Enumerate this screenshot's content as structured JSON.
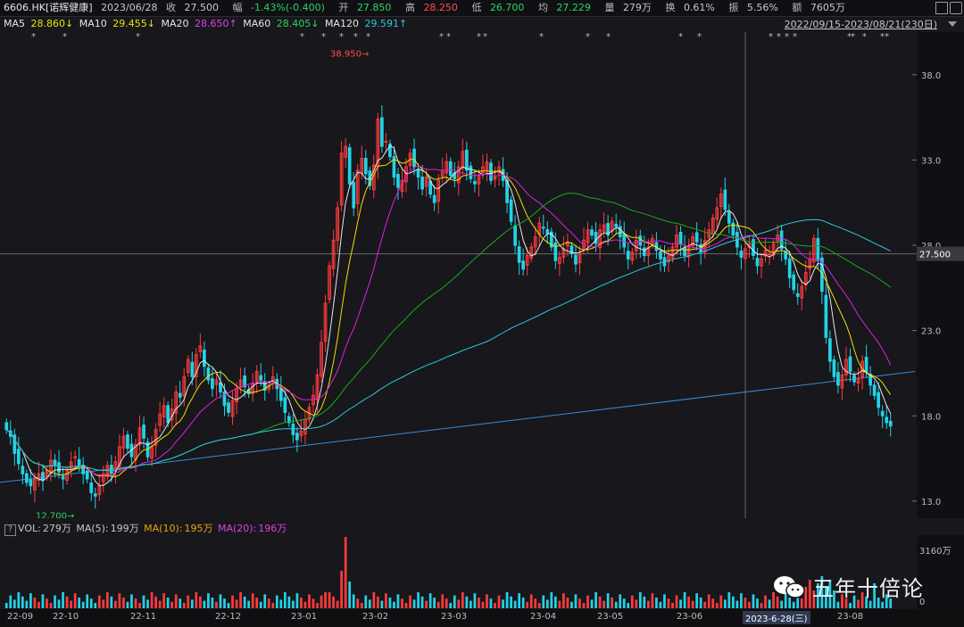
{
  "header": {
    "symbol": "6606.HK[诺辉健康]",
    "date": "2023/06/28",
    "close_label": "收",
    "close": "27.500",
    "change_label": "幅",
    "change": "-1.43%(-0.400)",
    "open_label": "开",
    "open": "27.850",
    "high_label": "高",
    "high": "28.250",
    "low_label": "低",
    "low": "26.700",
    "avg_label": "均",
    "avg": "27.229",
    "vol_label": "量",
    "vol": "279万",
    "turnover_label": "换",
    "turnover": "0.61%",
    "amp_label": "振",
    "amp": "5.56%",
    "amount_label": "额",
    "amount": "7605万"
  },
  "ma_legend": {
    "ma5_label": "MA5",
    "ma5": "28.860↓",
    "ma10_label": "MA10",
    "ma10": "29.455↓",
    "ma20_label": "MA20",
    "ma20": "28.650↑",
    "ma60_label": "MA60",
    "ma60": "28.405↓",
    "ma120_label": "MA120",
    "ma120": "29.591↑"
  },
  "date_range": "2022/09/15-2023/08/21(230日)",
  "price_axis": {
    "ticks": [
      "38.0",
      "33.0",
      "28.0",
      "23.0",
      "18.0",
      "13.0"
    ],
    "current": "27.500"
  },
  "annotations": {
    "high": "38.950",
    "low": "12.700"
  },
  "volume_header": {
    "help": "?",
    "vol_label": "VOL:",
    "vol": "279万",
    "ma5_label": "MA(5):",
    "ma5": "199万",
    "ma10_label": "MA(10):",
    "ma10": "195万",
    "ma20_label": "MA(20):",
    "ma20": "196万"
  },
  "volume_axis": {
    "top": "3160万",
    "bottom": "0"
  },
  "x_axis": {
    "labels": [
      "22-09",
      "22-10",
      "22-11",
      "22-12",
      "23-01",
      "23-02",
      "23-03",
      "23-04",
      "23-05",
      "23-06",
      "23-08"
    ],
    "highlight": "2023-6-28(三)"
  },
  "watermark": "五年十倍论",
  "colors": {
    "up": "#ff3b3b",
    "down": "#23d2e6",
    "ma5": "#e6e6e6",
    "ma10": "#f0e000",
    "ma20": "#e020e0",
    "ma60": "#1fa81f",
    "ma120": "#2ec8d8",
    "trend": "#3a8ad8"
  },
  "chart_data": {
    "type": "candlestick",
    "ylim": [
      12.0,
      40.5
    ],
    "closes": [
      17.2,
      16.8,
      15.8,
      15.2,
      14.6,
      14.1,
      13.9,
      14.3,
      14.6,
      14.2,
      14.8,
      15.4,
      15.1,
      14.7,
      14.3,
      14.8,
      15.3,
      15.6,
      15.1,
      14.6,
      14.3,
      13.5,
      13.3,
      13.9,
      14.6,
      15.1,
      14.6,
      15.3,
      16.2,
      16.8,
      16.1,
      15.6,
      16.3,
      17.3,
      16.7,
      15.6,
      16.2,
      17.2,
      18.1,
      18.6,
      17.6,
      18.4,
      19.4,
      19.1,
      20.3,
      21.3,
      20.3,
      21.6,
      22.1,
      20.9,
      20.1,
      19.6,
      20.1,
      19.4,
      18.6,
      18.2,
      18.9,
      19.6,
      20.1,
      19.7,
      19.3,
      19.9,
      20.6,
      20.1,
      19.5,
      19.8,
      20.3,
      19.6,
      18.9,
      18.2,
      17.6,
      16.9,
      16.6,
      17.1,
      17.8,
      18.5,
      19.2,
      20.4,
      22.3,
      24.6,
      26.8,
      28.3,
      30.2,
      33.4,
      33.8,
      31.6,
      30.2,
      32.4,
      33.1,
      32.2,
      31.5,
      32.7,
      35.4,
      33.8,
      34.1,
      33.2,
      32.0,
      31.4,
      31.8,
      32.6,
      33.4,
      32.6,
      32.0,
      31.3,
      32.0,
      31.0,
      30.5,
      31.8,
      32.4,
      32.9,
      32.1,
      31.9,
      32.6,
      33.5,
      32.4,
      31.9,
      31.6,
      32.1,
      32.6,
      32.9,
      31.8,
      32.0,
      32.6,
      31.8,
      30.5,
      29.4,
      28.0,
      27.0,
      26.6,
      27.4,
      27.9,
      28.5,
      29.3,
      29.0,
      28.7,
      27.9,
      27.1,
      27.3,
      27.8,
      28.2,
      27.5,
      26.9,
      27.6,
      28.3,
      28.9,
      28.6,
      28.1,
      28.9,
      29.2,
      28.6,
      29.4,
      29.1,
      28.5,
      27.9,
      27.2,
      27.6,
      28.3,
      28.0,
      27.4,
      27.9,
      28.4,
      27.7,
      27.2,
      26.8,
      27.4,
      27.9,
      28.6,
      28.1,
      27.4,
      27.9,
      28.5,
      28.2,
      27.6,
      28.3,
      28.9,
      29.6,
      30.2,
      31.0,
      30.1,
      29.3,
      28.6,
      27.9,
      27.3,
      27.8,
      28.1,
      27.4,
      26.8,
      27.2,
      27.7,
      27.5,
      28.1,
      28.6,
      27.8,
      27.2,
      26.1,
      25.4,
      25.0,
      25.6,
      26.4,
      27.2,
      28.4,
      27.1,
      25.3,
      22.6,
      21.2,
      20.3,
      19.8,
      20.4,
      21.3,
      20.6,
      20.0,
      20.2,
      21.2,
      20.6,
      19.8,
      19.2,
      18.5,
      18.0,
      17.6,
      17.4
    ],
    "annotations": [
      {
        "label": "38.950",
        "type": "high"
      },
      {
        "label": "12.700",
        "type": "low"
      }
    ]
  }
}
